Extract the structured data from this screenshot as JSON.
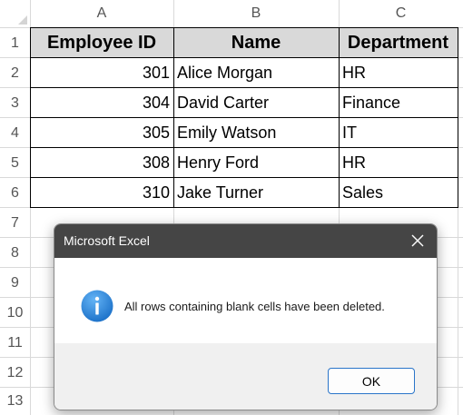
{
  "sheet": {
    "column_headers": [
      "A",
      "B",
      "C"
    ],
    "row_headers": [
      "1",
      "2",
      "3",
      "4",
      "5",
      "6",
      "7",
      "8",
      "9",
      "10",
      "11",
      "12",
      "13"
    ],
    "table": {
      "headers": [
        "Employee ID",
        "Name",
        "Department"
      ],
      "rows": [
        [
          "301",
          "Alice Morgan",
          "HR"
        ],
        [
          "304",
          "David Carter",
          "Finance"
        ],
        [
          "305",
          "Emily Watson",
          "IT"
        ],
        [
          "308",
          "Henry Ford",
          "HR"
        ],
        [
          "310",
          "Jake Turner",
          "Sales"
        ]
      ]
    }
  },
  "dialog": {
    "title": "Microsoft Excel",
    "message": "All rows containing blank cells have been deleted.",
    "ok_label": "OK",
    "icon": "info-icon",
    "close_icon": "close-icon"
  },
  "colors": {
    "header_fill": "#d9d9d9",
    "dialog_titlebar": "#454545",
    "info_icon_blue": "#1f7ad6",
    "ok_border": "#2a75c9"
  }
}
